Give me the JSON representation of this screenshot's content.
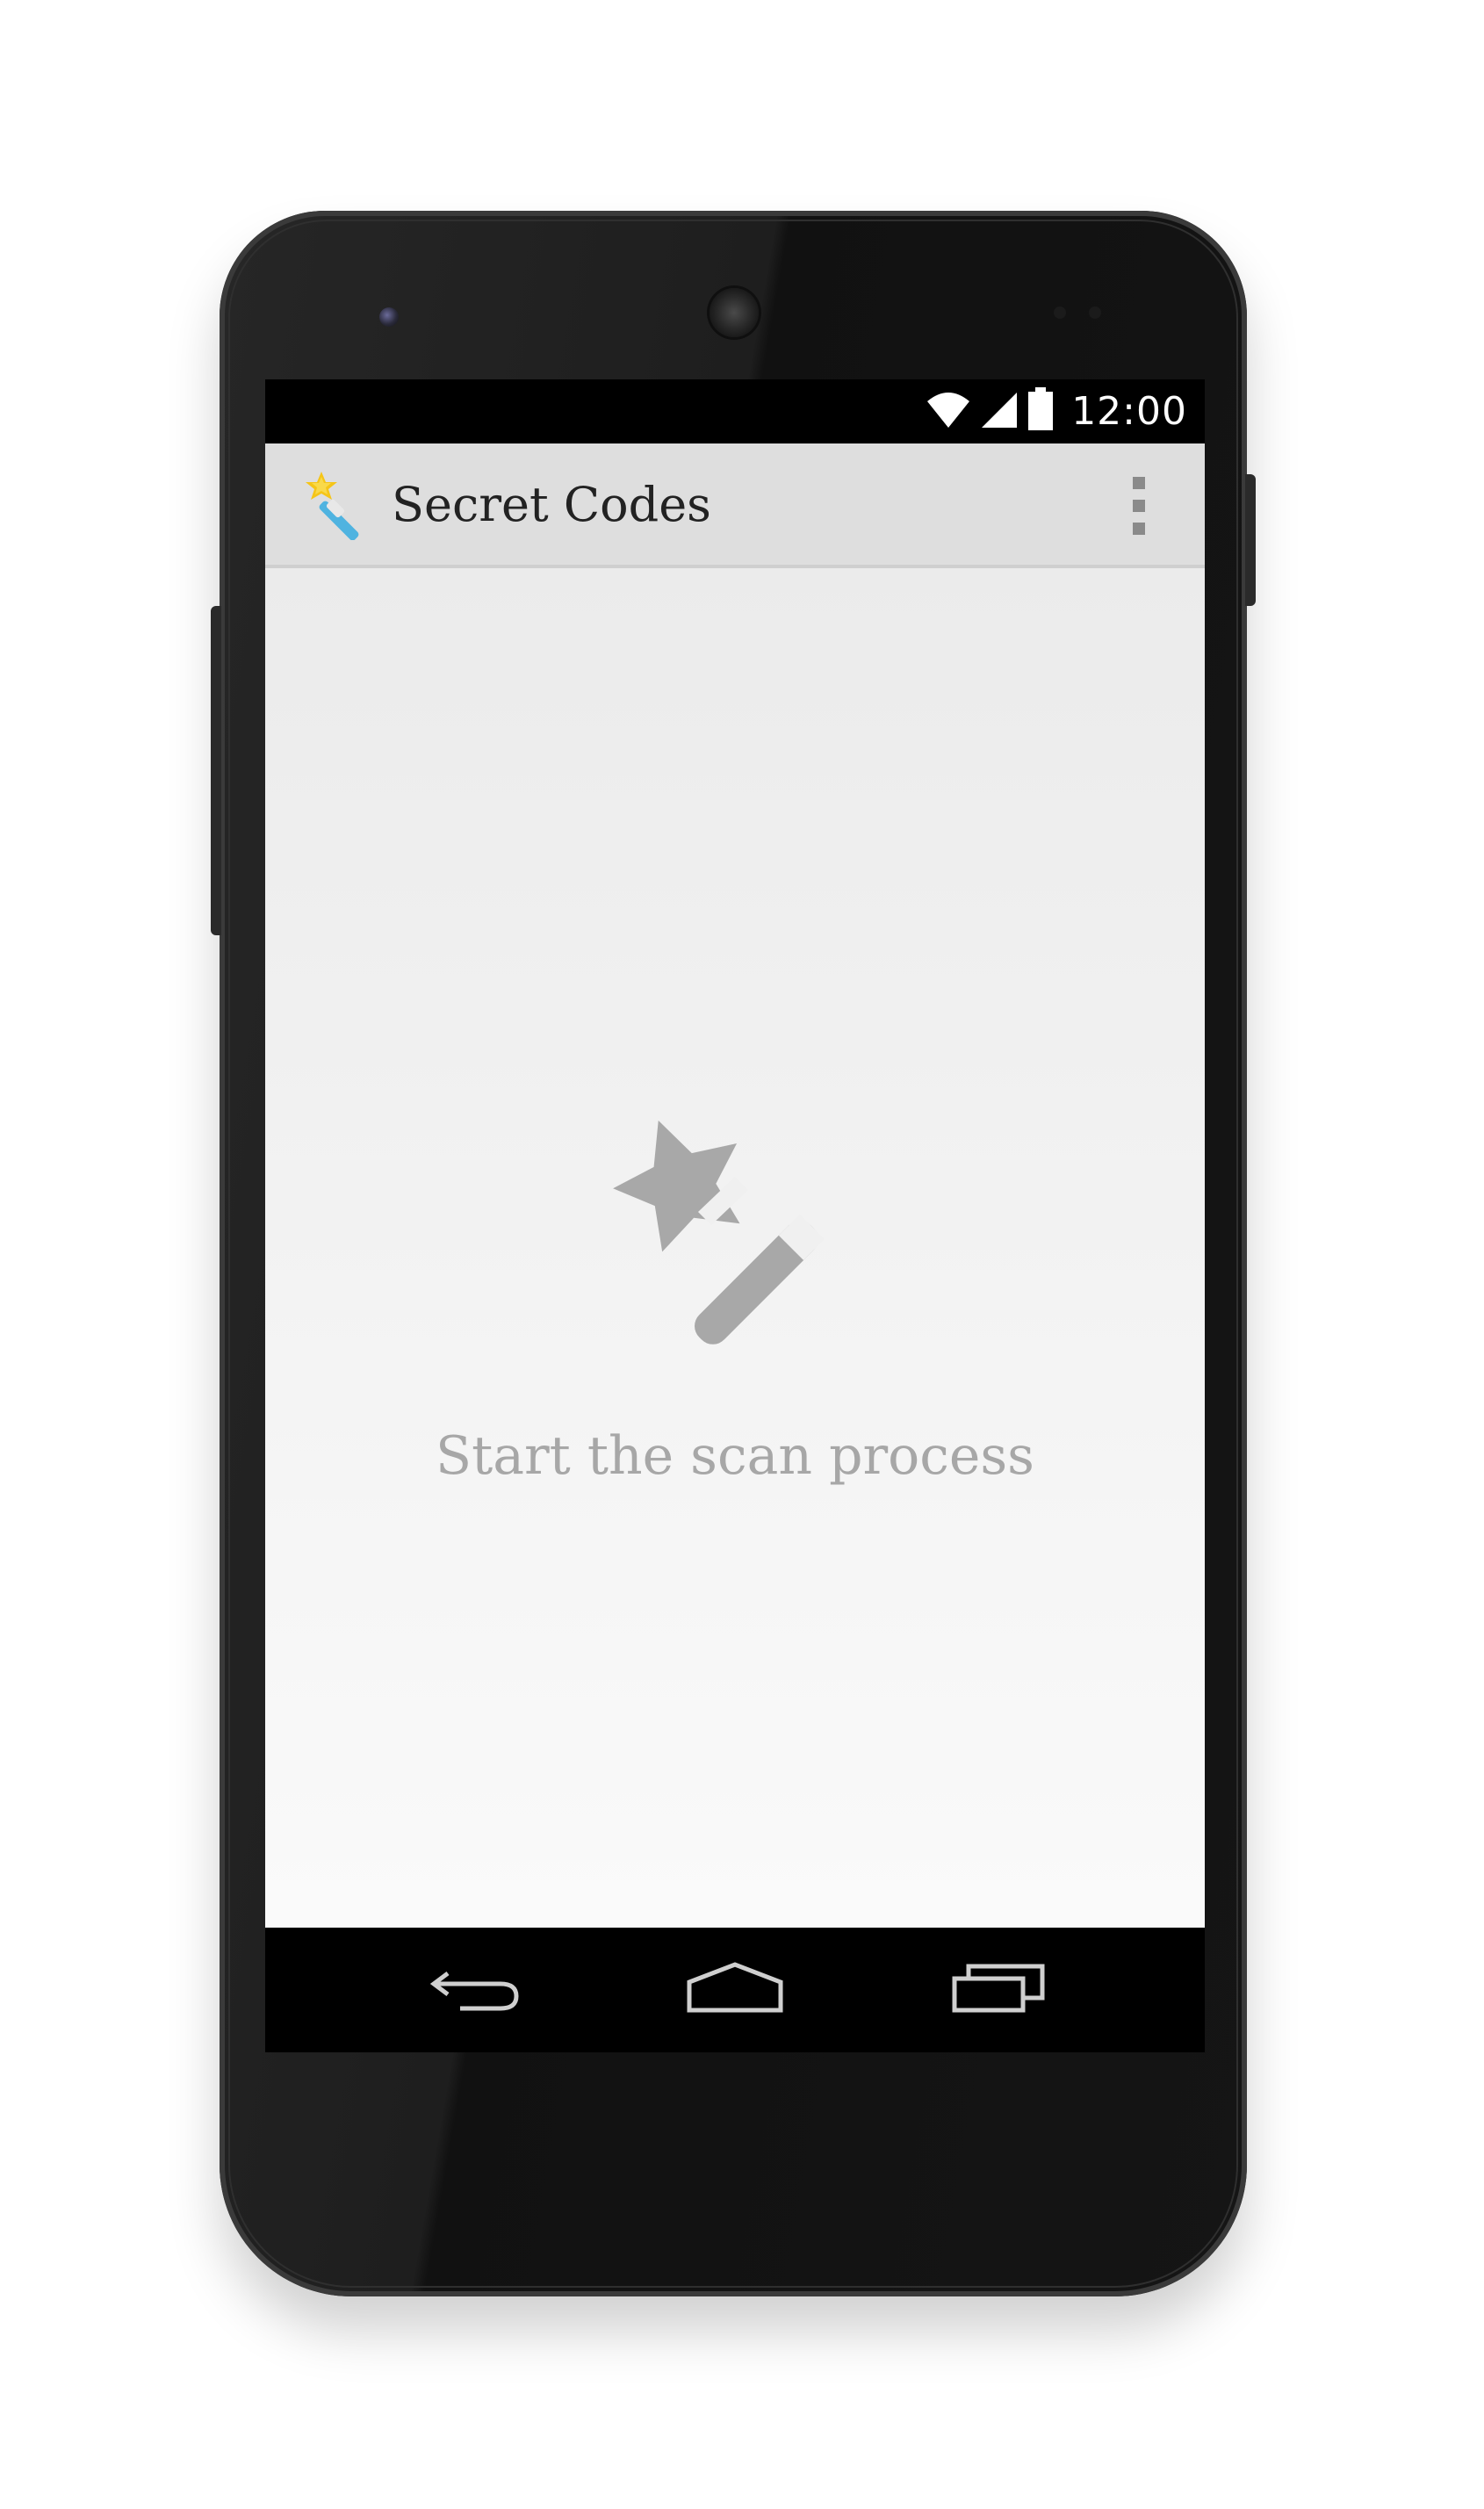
{
  "device": {
    "model": "smartphone"
  },
  "status_bar": {
    "time": "12:00",
    "icons": [
      "wifi-icon",
      "signal-icon",
      "battery-icon"
    ]
  },
  "action_bar": {
    "app_icon": "magic-wand-icon",
    "title": "Secret Codes",
    "overflow_icon": "overflow-menu-icon"
  },
  "content": {
    "illustration_icon": "magic-wand-icon",
    "message": "Start the scan process"
  },
  "navigation_bar": {
    "buttons": [
      {
        "icon": "back-icon"
      },
      {
        "icon": "home-icon"
      },
      {
        "icon": "recents-icon"
      }
    ]
  },
  "colors": {
    "action_bar_bg": "#dedede",
    "content_bg": "#f0f0f0",
    "message_text": "#a7a7a7",
    "illustration": "#a8a8a8",
    "title_text": "#222222"
  }
}
